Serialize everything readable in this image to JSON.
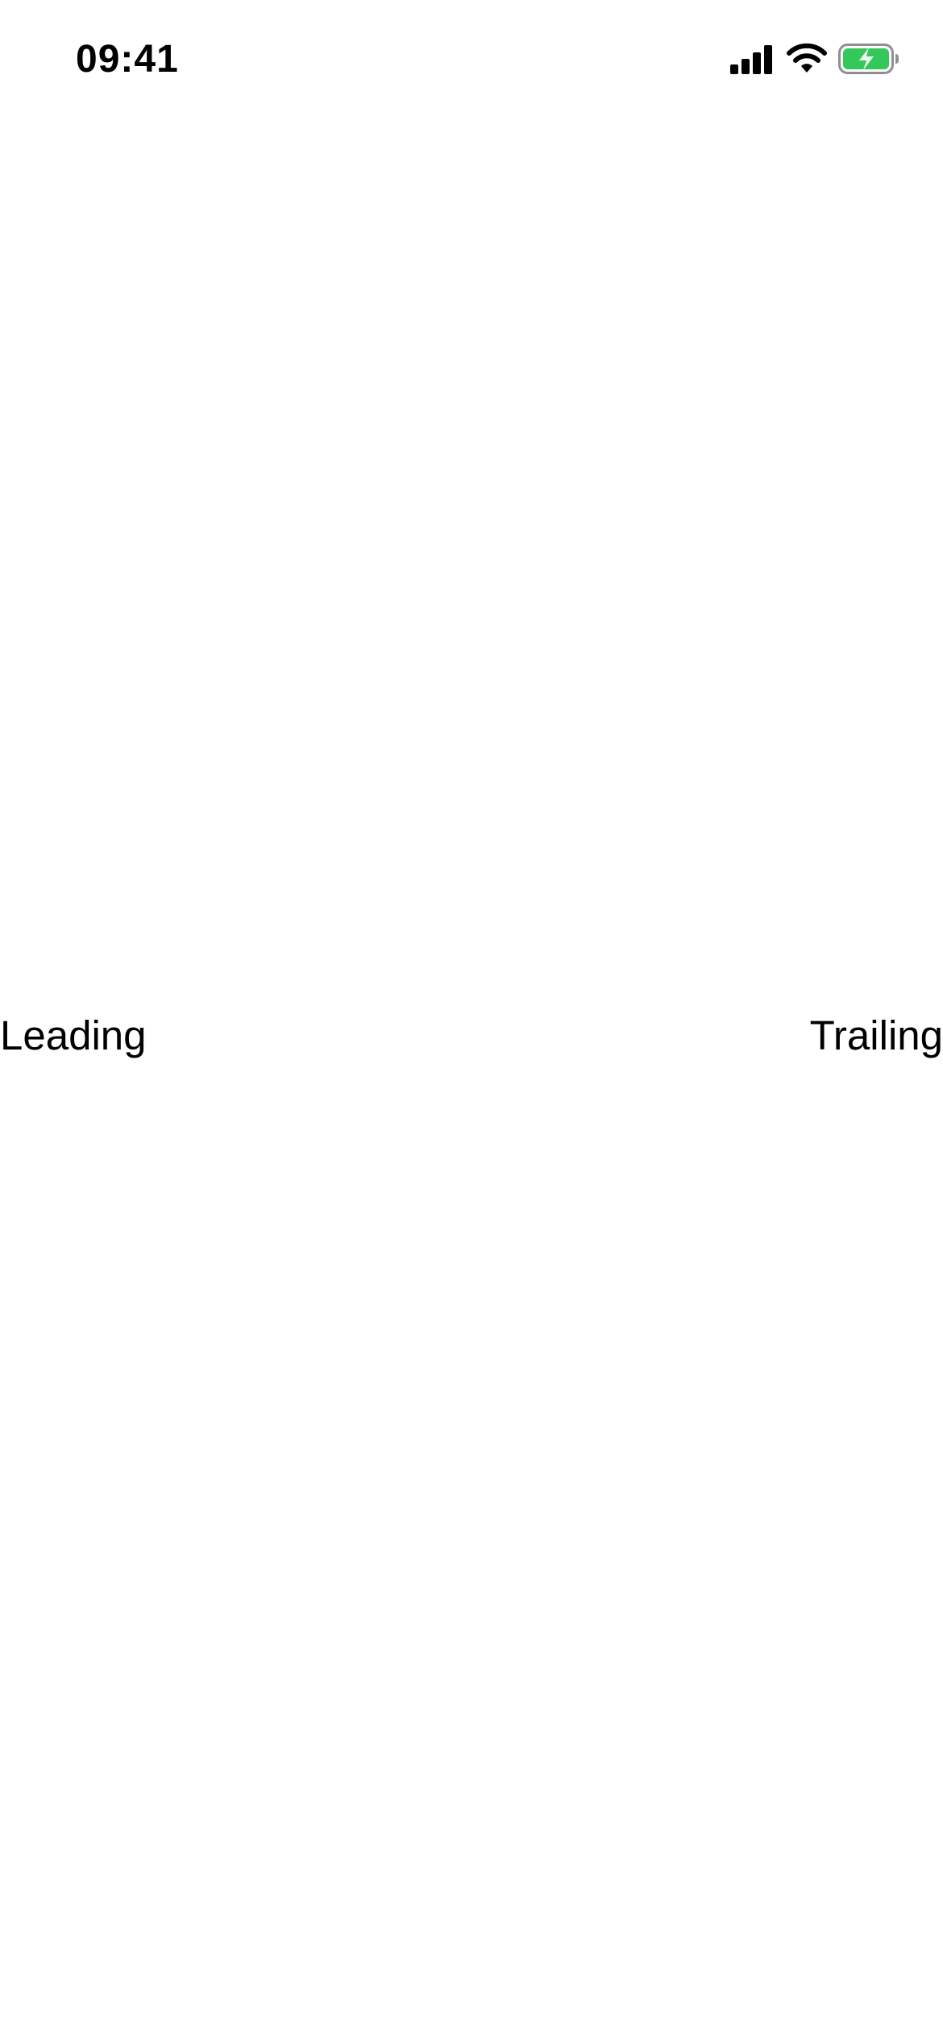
{
  "status_bar": {
    "time": "09:41",
    "icons": [
      "cellular-signal-icon",
      "wifi-icon",
      "battery-charging-icon"
    ],
    "battery_color": "#34C759"
  },
  "main": {
    "leading_label": "Leading",
    "trailing_label": "Trailing"
  }
}
